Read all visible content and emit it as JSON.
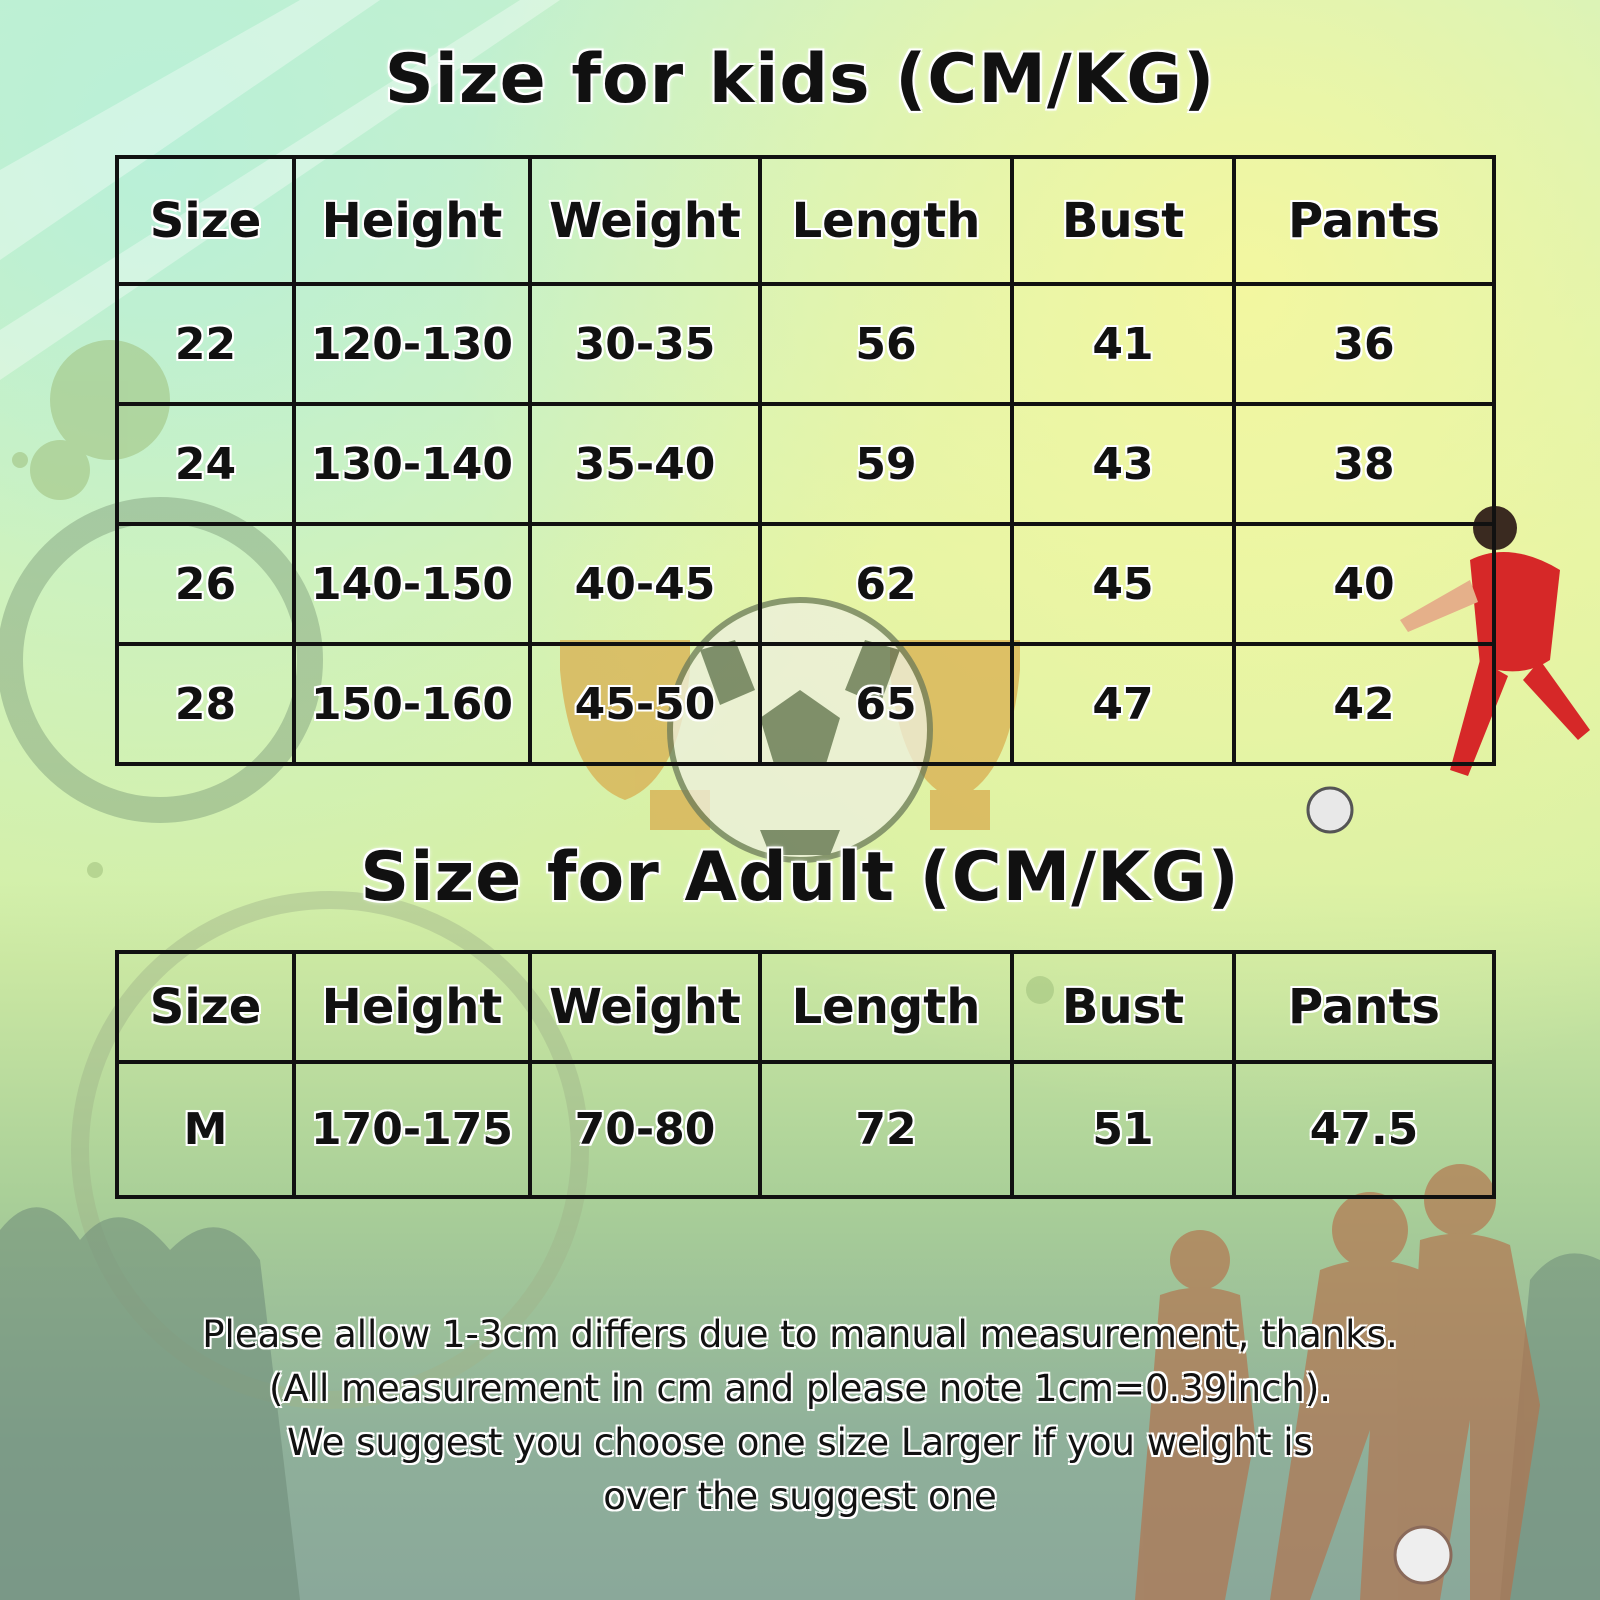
{
  "kids": {
    "title": "Size  for kids  (CM/KG)",
    "headers": [
      "Size",
      "Height",
      "Weight",
      "Length",
      "Bust",
      "Pants"
    ],
    "rows": [
      [
        "22",
        "120-130",
        "30-35",
        "56",
        "41",
        "36"
      ],
      [
        "24",
        "130-140",
        "35-40",
        "59",
        "43",
        "38"
      ],
      [
        "26",
        "140-150",
        "40-45",
        "62",
        "45",
        "40"
      ],
      [
        "28",
        "150-160",
        "45-50",
        "65",
        "47",
        "42"
      ]
    ]
  },
  "adult": {
    "title": "Size  for Adult  (CM/KG)",
    "headers": [
      "Size",
      "Height",
      "Weight",
      "Length",
      "Bust",
      "Pants"
    ],
    "rows": [
      [
        "M",
        "170-175",
        "70-80",
        "72",
        "51",
        "47.5"
      ]
    ]
  },
  "note": {
    "lines": [
      "Please allow 1-3cm differs due to manual measurement, thanks.",
      "(All measurement in cm and please note 1cm=0.39inch).",
      "We suggest you choose one size Larger if you weight is",
      "over the suggest one"
    ]
  },
  "colors": {
    "background_top": "#c9f0c8",
    "background_mid": "#dff3a8",
    "background_bottom": "#8aa89a",
    "table_border": "#111111",
    "text": "#111111"
  }
}
